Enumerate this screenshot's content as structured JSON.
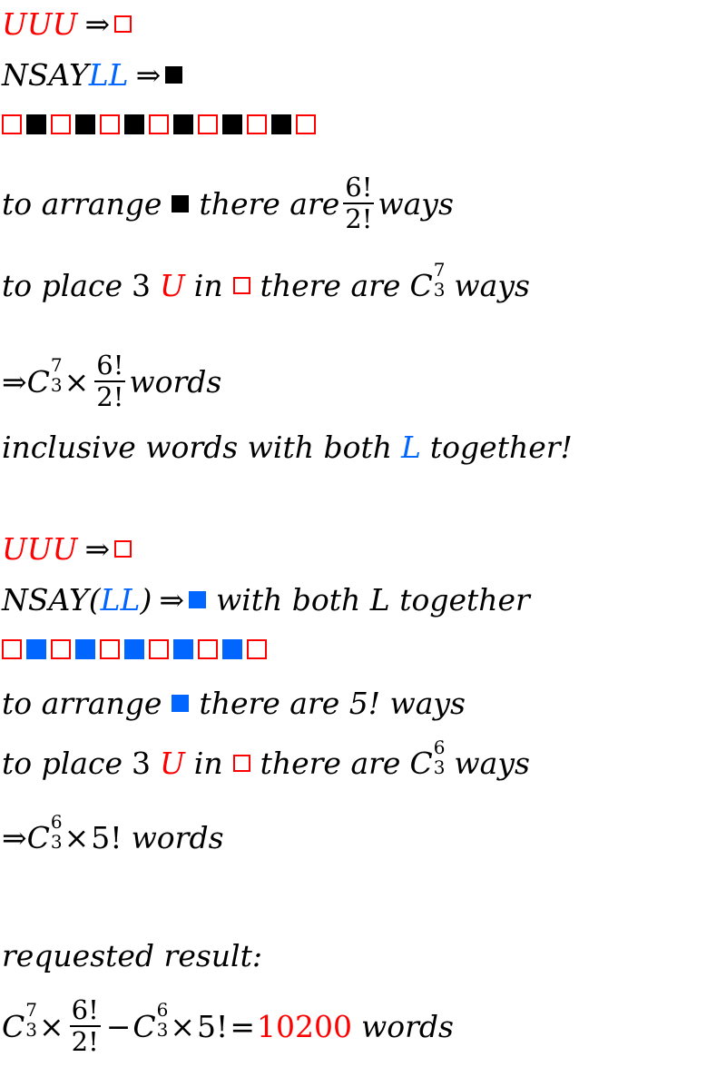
{
  "section1": {
    "line1": {
      "letters": "UUU",
      "arrow": "⇒"
    },
    "line2": {
      "letters": "NSAY",
      "letters_blue": "LL",
      "arrow": "⇒"
    },
    "pattern": [
      "empty",
      "black",
      "empty",
      "black",
      "empty",
      "black",
      "empty",
      "black",
      "empty",
      "black",
      "empty",
      "black",
      "empty"
    ],
    "arrange": {
      "prefix": "to arrange",
      "middle": "there are",
      "num": "6!",
      "den": "2!",
      "suffix": "ways"
    },
    "place": {
      "prefix": "to place",
      "count": "3",
      "letter": "U",
      "in": "in",
      "middle": "there are",
      "C": "C",
      "n": "7",
      "k": "3",
      "suffix": "ways"
    },
    "total": {
      "arrow": "⇒",
      "C": "C",
      "n": "7",
      "k": "3",
      "times": "×",
      "num": "6!",
      "den": "2!",
      "suffix": "words"
    },
    "note": {
      "prefix": "inclusive words with both",
      "letter": "L",
      "suffix": "together!"
    }
  },
  "section2": {
    "line1": {
      "letters": "UUU",
      "arrow": "⇒"
    },
    "line2": {
      "letters": "NSAY(",
      "letters_blue": "LL",
      "close": ")",
      "arrow": "⇒",
      "suffix": "with both L together"
    },
    "pattern": [
      "empty",
      "blue",
      "empty",
      "blue",
      "empty",
      "blue",
      "empty",
      "blue",
      "empty",
      "blue",
      "empty"
    ],
    "arrange": {
      "prefix": "to arrange",
      "middle": "there are 5! ways"
    },
    "place": {
      "prefix": "to place",
      "count": "3",
      "letter": "U",
      "in": "in",
      "middle": "there are",
      "C": "C",
      "n": "6",
      "k": "3",
      "suffix": "ways"
    },
    "total": {
      "arrow": "⇒",
      "C": "C",
      "n": "6",
      "k": "3",
      "times": "×",
      "fact": "5!",
      "suffix": "words"
    }
  },
  "result": {
    "label": "requested result:",
    "C1": "C",
    "n1": "7",
    "k1": "3",
    "times": "×",
    "num": "6!",
    "den": "2!",
    "minus": "−",
    "C2": "C",
    "n2": "6",
    "k2": "3",
    "fact": "5!",
    "equals": "=",
    "value": "10200",
    "suffix": "words"
  },
  "colors": {
    "highlight_red": "#ff0000",
    "highlight_blue": "#0066ff"
  }
}
